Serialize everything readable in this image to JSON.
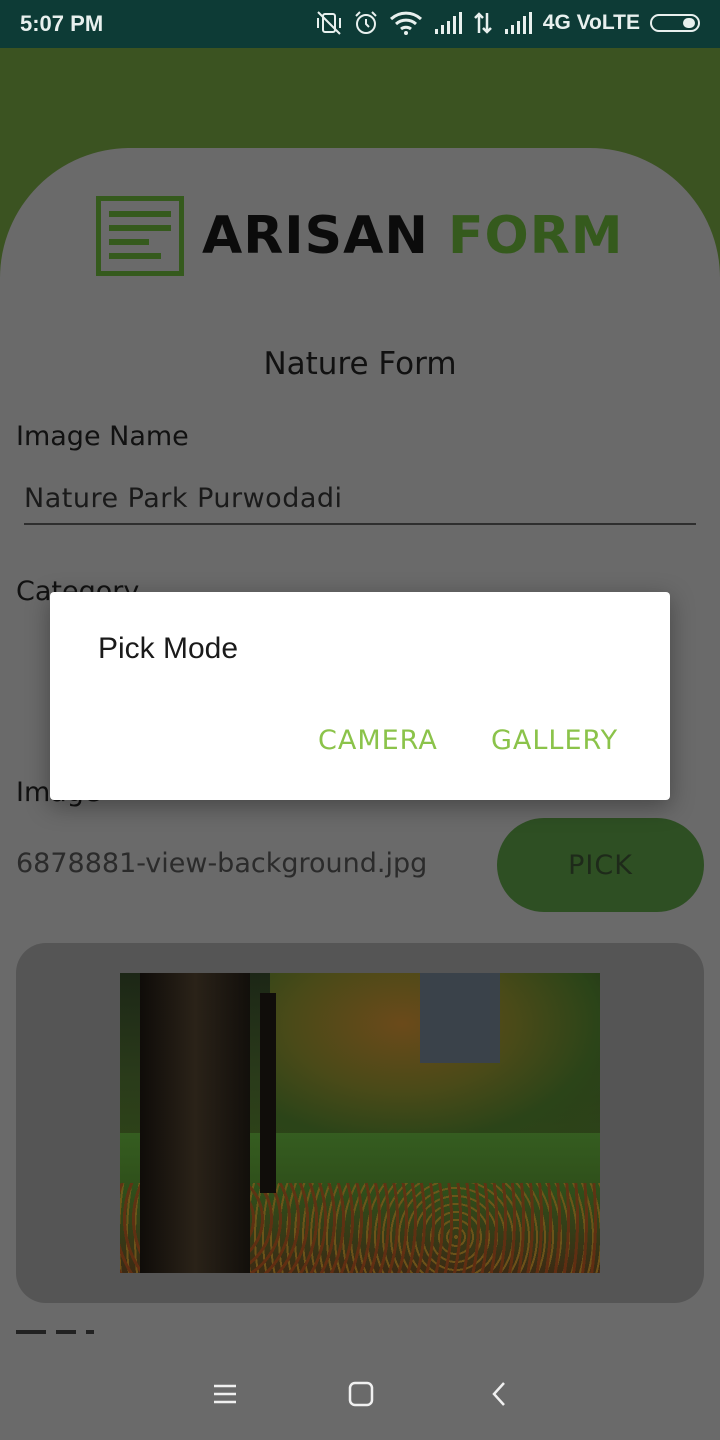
{
  "status_bar": {
    "time": "5:07 PM",
    "network": "4G VoLTE"
  },
  "logo": {
    "word1": "ARISAN",
    "word2": "FORM"
  },
  "form": {
    "title": "Nature Form",
    "image_name_label": "Image Name",
    "image_name_value": "Nature Park Purwodadi",
    "category_label": "Category",
    "image_label": "Image",
    "image_filename": "6878881-view-background.jpg",
    "pick_button": "PICK"
  },
  "dialog": {
    "title": "Pick Mode",
    "camera_button": "CAMERA",
    "gallery_button": "GALLERY"
  },
  "colors": {
    "status_bar": "#0d3b36",
    "header_green": "#3b5321",
    "brand_green": "#355a1d",
    "dialog_button": "#8bc34a",
    "pick_button": "#2e4f23"
  },
  "icons": [
    "mute-vibrate-icon",
    "alarm-icon",
    "wifi-icon",
    "signal-icon",
    "data-arrows-icon",
    "signal-icon",
    "battery-icon",
    "menu-icon",
    "home-icon",
    "back-icon"
  ]
}
